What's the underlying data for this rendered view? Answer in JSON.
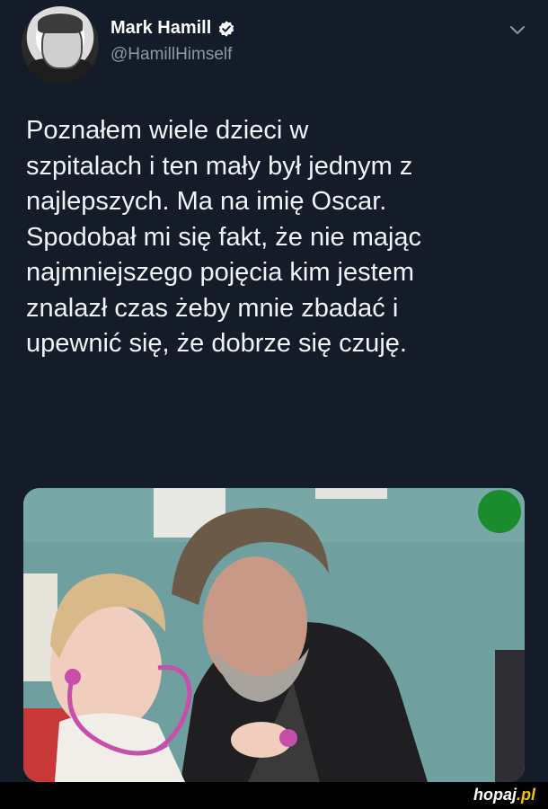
{
  "tweet": {
    "author": {
      "display_name": "Mark Hamill",
      "handle": "@HamillHimself",
      "verified_icon": "verified-badge-icon",
      "avatar_icon": "avatar"
    },
    "menu_icon": "chevron-down-icon",
    "text": "Poznałem wiele dzieci w\nszpitalach i ten mały był jednym z\nnajlepszych. Ma na imię Oscar.\nSpodobał mi się fakt, że nie mając\nnajmniejszego pojęcia kim jestem\nznalazł czas żeby mnie zbadać i\nupewnić się, że dobrze się czuję.",
    "media": {
      "type": "photo"
    }
  },
  "watermark": {
    "part1": "hopaj",
    "part2": ".pl"
  },
  "colors": {
    "background": "#141b29",
    "verified": "#ffffff",
    "handle": "#8b98a5",
    "watermark_accent": "#f5c400"
  }
}
